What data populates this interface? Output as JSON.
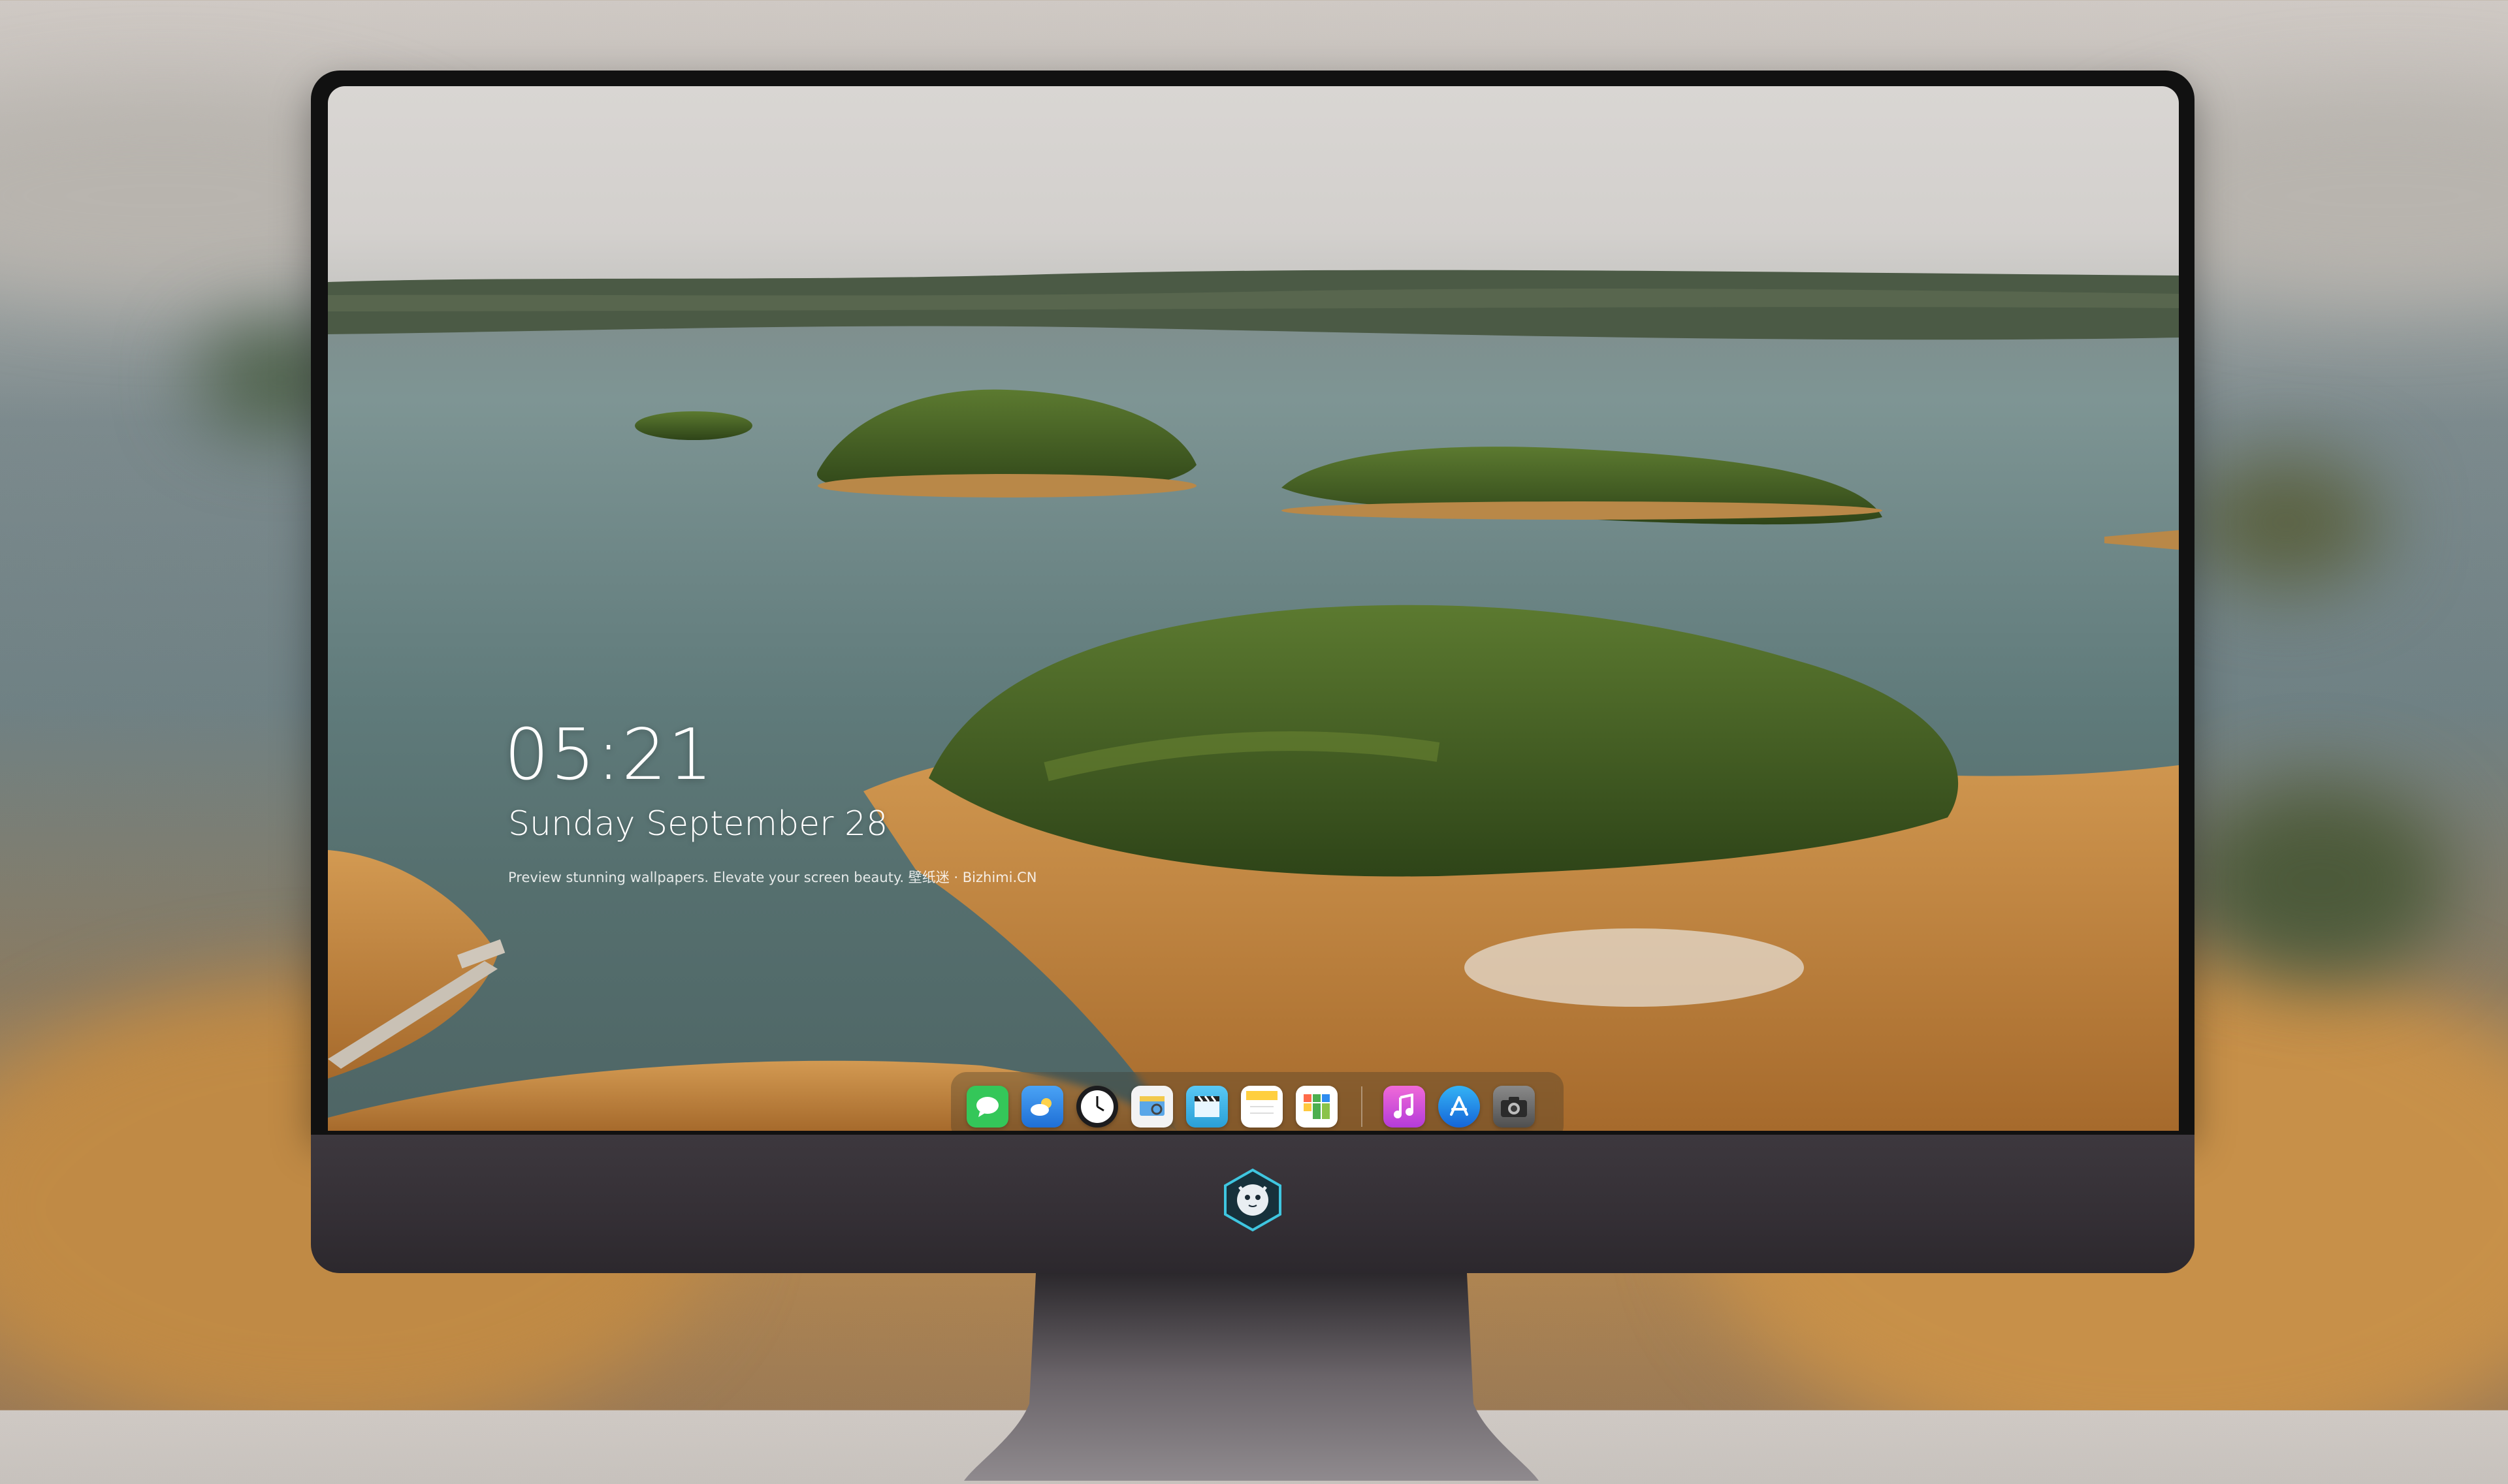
{
  "lockscreen": {
    "time": "05:21",
    "date": "Sunday September  28",
    "tagline": "Preview stunning wallpapers. Elevate your screen beauty. 壁纸迷 · Bizhimi.CN"
  },
  "dock": {
    "apps": [
      {
        "name": "messages-icon",
        "color": "#34c759"
      },
      {
        "name": "weather-icon",
        "color": "#2f8cf0"
      },
      {
        "name": "clock-icon",
        "color": "#1c1c1e"
      },
      {
        "name": "preview-icon",
        "color": "#f2c94c"
      },
      {
        "name": "clips-icon",
        "color": "#4fc3f7"
      },
      {
        "name": "notes-icon",
        "color": "#ffd54f"
      },
      {
        "name": "numbers-icon",
        "color": "#4caf50"
      },
      {
        "name": "itunes-icon",
        "color": "#d84dd8"
      },
      {
        "name": "app-store-icon",
        "color": "#1e88e5"
      },
      {
        "name": "camera-icon",
        "color": "#6b6b6b"
      }
    ]
  },
  "colors": {
    "bezel": "#111111",
    "chin": "#342f35",
    "reeds": "#c58a3e",
    "forest": "#3e5a23"
  }
}
